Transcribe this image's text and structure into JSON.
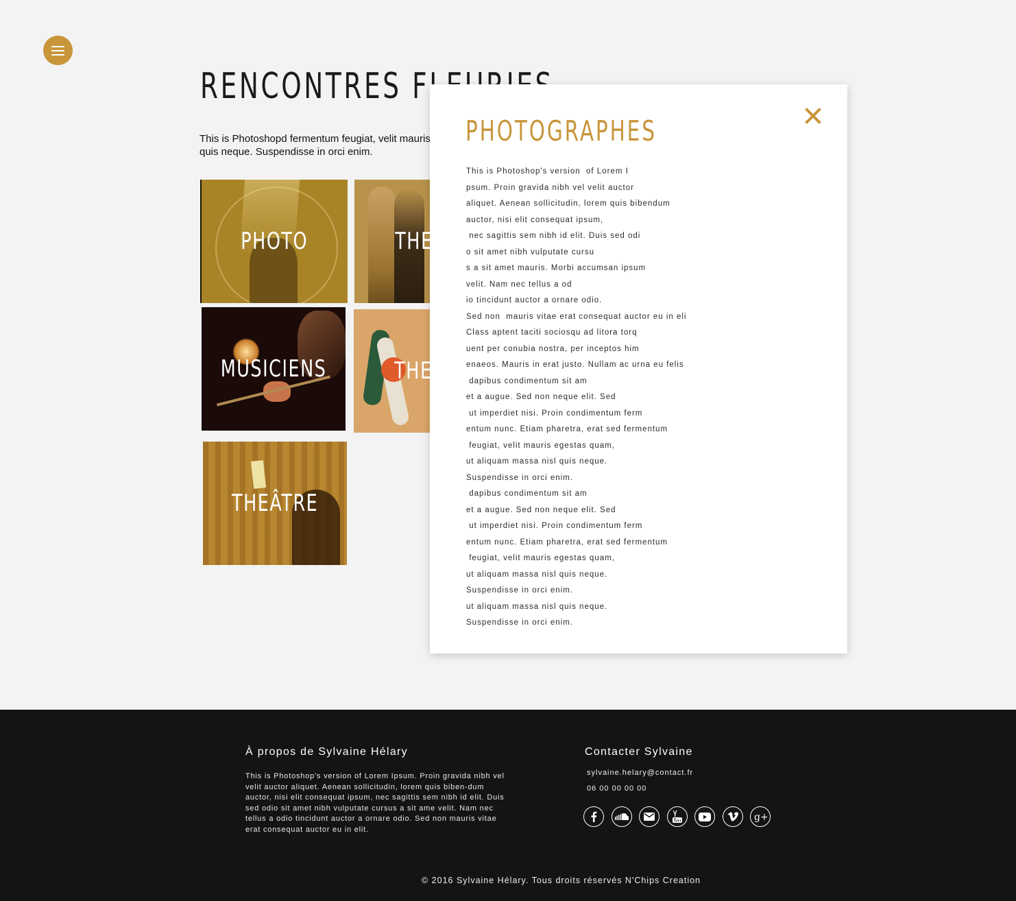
{
  "colors": {
    "accent": "#c8953a",
    "background": "#f3f3f3",
    "footer": "#141414"
  },
  "header": {
    "menu_icon": "hamburger-icon"
  },
  "page": {
    "title": "RENCONTRES FLEURIES",
    "intro": "This is Photoshopd fermentum feugiat, velit mauris egestas quam, ut aliquam massa nisl quis neque. Suspendisse in orci enim."
  },
  "tiles": [
    {
      "label": "PHOTO"
    },
    {
      "label": "THE"
    },
    {
      "label": "MUSICIENS"
    },
    {
      "label": "THE"
    },
    {
      "label": "THEÂTRE"
    }
  ],
  "modal": {
    "title": "PHOTOGRAPHES",
    "close_icon": "close-icon",
    "lines": [
      "This is Photoshop's version  of Lorem I",
      "psum. Proin gravida nibh vel velit auctor",
      "aliquet. Aenean sollicitudin, lorem quis bibendum",
      "auctor, nisi elit consequat ipsum,",
      " nec sagittis sem nibh id elit. Duis sed odi",
      "o sit amet nibh vulputate cursu",
      "s a sit amet mauris. Morbi accumsan ipsum",
      "velit. Nam nec tellus a od",
      "io tincidunt auctor a ornare odio.",
      "Sed non  mauris vitae erat consequat auctor eu in eli",
      "Class aptent taciti sociosqu ad litora torq",
      "uent per conubia nostra, per inceptos him",
      "enaeos. Mauris in erat justo. Nullam ac urna eu felis",
      " dapibus condimentum sit am",
      "et a augue. Sed non neque elit. Sed",
      " ut imperdiet nisi. Proin condimentum ferm",
      "entum nunc. Etiam pharetra, erat sed fermentum",
      " feugiat, velit mauris egestas quam,",
      "ut aliquam massa nisl quis neque.",
      "Suspendisse in orci enim.",
      " dapibus condimentum sit am",
      "et a augue. Sed non neque elit. Sed",
      " ut imperdiet nisi. Proin condimentum ferm",
      "entum nunc. Etiam pharetra, erat sed fermentum",
      " feugiat, velit mauris egestas quam,",
      "ut aliquam massa nisl quis neque.",
      "Suspendisse in orci enim.",
      "ut aliquam massa nisl quis neque.",
      "Suspendisse in orci enim."
    ]
  },
  "footer": {
    "about_title": "À propos de Sylvaine Hélary",
    "about_text": "This is Photoshop's version  of Lorem Ipsum. Proin gravida nibh vel velit auctor aliquet. Aenean sollicitudin, lorem quis biben-dum auctor, nisi elit consequat ipsum, nec sagittis sem nibh id elit. Duis sed odio sit amet nibh vulputate cursus a sit ame velit. Nam nec tellus a odio tincidunt auctor a ornare odio. Sed non mauris vitae erat consequat auctor eu in elit.",
    "contact_title": "Contacter Sylvaine",
    "email": "sylvaine.helary@contact.fr",
    "phone": "06 00 00 00 00",
    "socials": [
      "facebook-icon",
      "soundcloud-icon",
      "email-icon",
      "youtube-icon",
      "youtube-play-icon",
      "vimeo-icon",
      "google-plus-icon"
    ],
    "copyright": "© 2016 Sylvaine Hélary. Tous droits réservés N'Chips Creation"
  }
}
